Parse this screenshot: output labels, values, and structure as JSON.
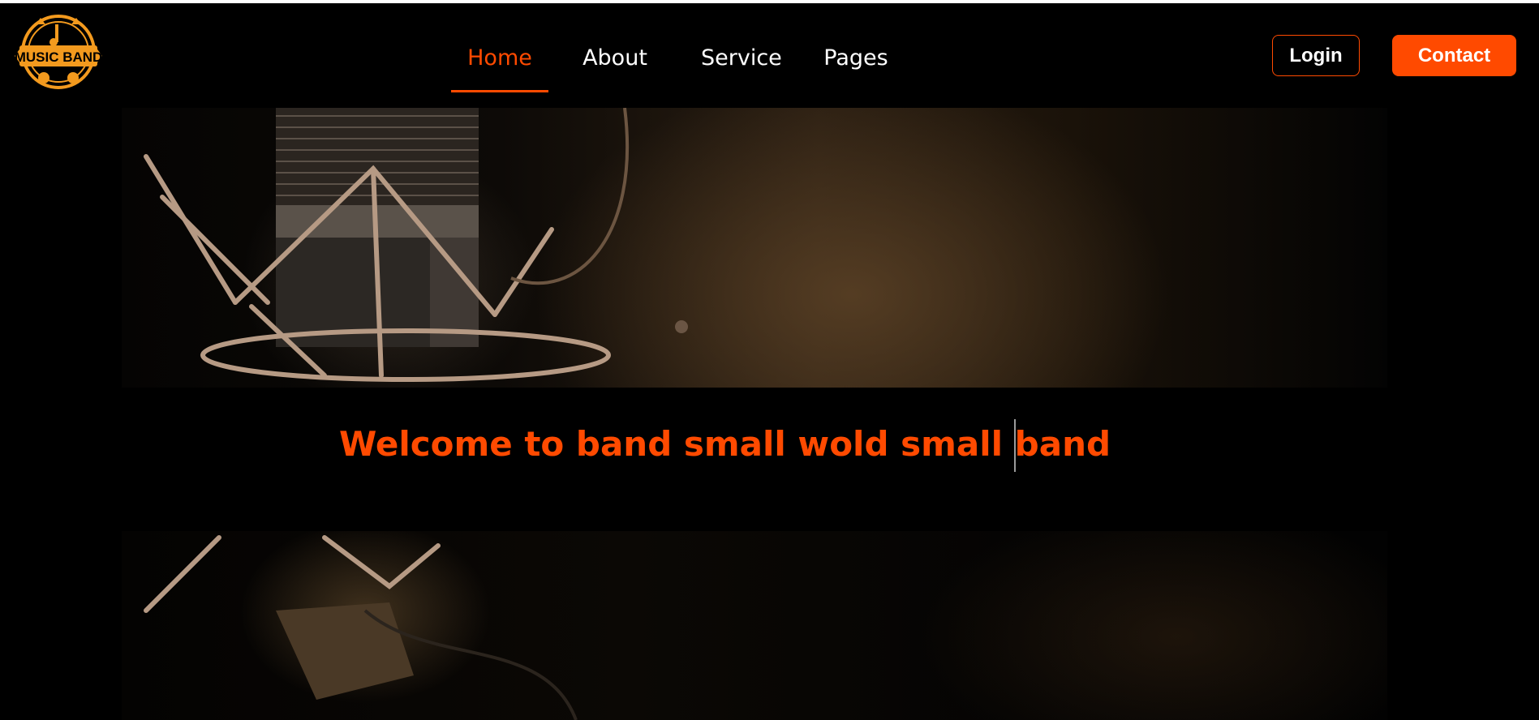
{
  "colors": {
    "accent": "#ff4a00",
    "logo": "#f39a1e",
    "background": "#000000",
    "text": "#ffffff"
  },
  "header": {
    "logo": {
      "text": "MUSIC BAND",
      "icon": "music-band-badge-icon"
    },
    "nav": [
      {
        "label": "Home",
        "active": true
      },
      {
        "label": "About",
        "active": false
      },
      {
        "label": "Service",
        "active": false
      },
      {
        "label": "Pages",
        "active": false
      }
    ],
    "login_label": "Login",
    "contact_label": "Contact"
  },
  "hero": {
    "image": "studio-microphone-image",
    "heading": "Welcome to band small wold small band"
  }
}
